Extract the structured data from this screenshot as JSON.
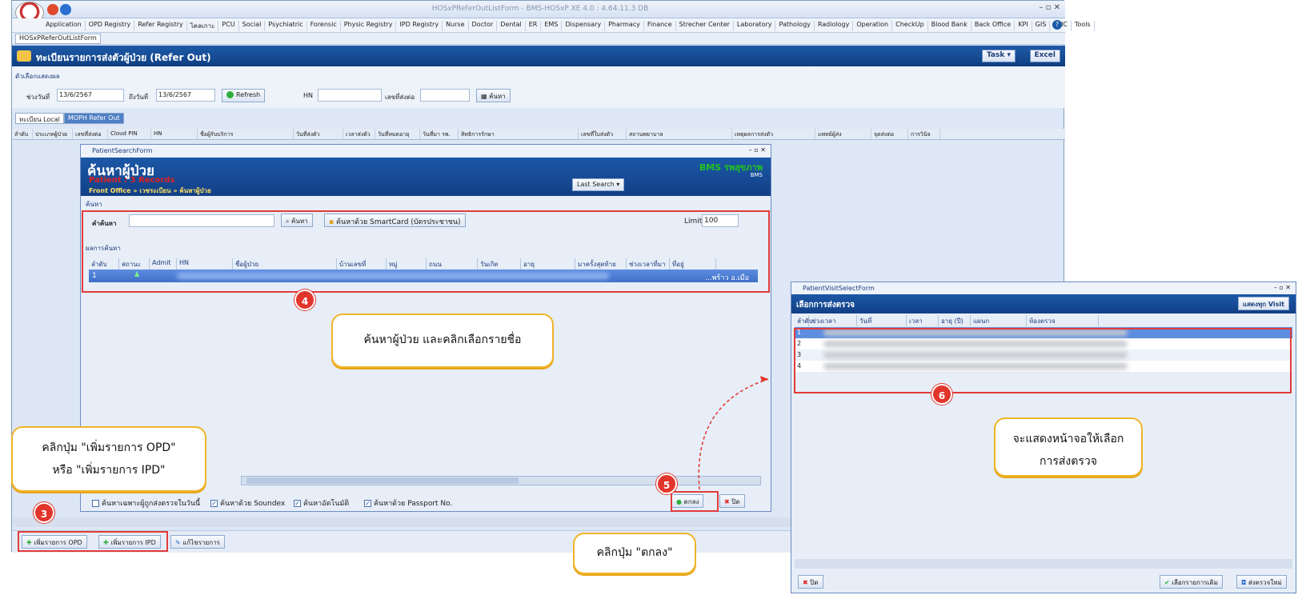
{
  "window": {
    "title": "HOSxPReferOutListForm - BMS-HOSxP XE 4.0 : 4.64.11.3 DB",
    "controls": "– ▫ ✕"
  },
  "menu": [
    "Application",
    "OPD Registry",
    "Refer Registry",
    "ไคลเกาะ",
    "PCU",
    "Social",
    "Psychiatric",
    "Forensic",
    "Physic Registry",
    "IPD Registry",
    "Nurse",
    "Doctor",
    "Dental",
    "ER",
    "EMS",
    "Dispensary",
    "Pharmacy",
    "Finance",
    "Strecher Center",
    "Laboratory",
    "Pathology",
    "Radiology",
    "Operation",
    "CheckUp",
    "Blood Bank",
    "Back Office",
    "KPI",
    "GIS",
    "HHC",
    "Tools"
  ],
  "doc_tab": "HOSxPReferOutListForm",
  "header": {
    "title": "ทะเบียนรายการส่งตัวผู้ป่วย (Refer Out)",
    "task": "Task ▾",
    "excel": "Excel"
  },
  "filter": {
    "section": "ตัวเลือกแสดงผล",
    "from_label": "ช่วงวันที่",
    "from": "13/6/2567",
    "to_label": "ถึงวันที่",
    "to": "13/6/2567",
    "refresh": "Refresh",
    "hn_label": "HN",
    "refer_label": "เลขที่ส่งต่อ",
    "search": "ค้นหา"
  },
  "tabs": [
    "ทะเบียน Local",
    "MOPH Refer Out"
  ],
  "grid_cols": [
    "ลำดับ",
    "ประเภทผู้ป่วย",
    "เลขที่ส่งต่อ",
    "Cloud PIN",
    "HN",
    "ชื่อผู้รับบริการ",
    "วันที่ส่งตัว",
    "เวลาส่งตัว",
    "วันที่หมดอายุ",
    "วันที่มา รพ.",
    "สิทธิการรักษา",
    "เลขที่ใบส่งตัว",
    "สถานพยาบาล",
    "เหตุผลการส่งตัว",
    "แพทย์ผู้ส่ง",
    "จุดส่งต่อ",
    "การวินิจ"
  ],
  "bottom": {
    "add_opd": "เพิ่มรายการ OPD",
    "add_ipd": "เพิ่มรายการ IPD",
    "edit": "แก้ไขรายการ"
  },
  "psf": {
    "title": "PatientSearchForm",
    "heading": "ค้นหาผู้ป่วย",
    "records": "Patient : 3 Records",
    "crumb": "Front Office » เวชระเบียน » ค้นหาผู้ป่วย",
    "bms": "BMS รพสุขภาพ",
    "bms_sub": "BMS",
    "last_search": "Last Search ▾",
    "search_group": "ค้นหา",
    "keyword_label": "คำค้นหา",
    "search_btn": "ค้นหา",
    "smartcard_btn": "ค้นหาด้วย SmartCard (บัตรประชาชน)",
    "limit_label": "Limit",
    "limit": "100",
    "results_label": "ผลการค้นหา",
    "cols": [
      "ลำดับ",
      "สถานะ",
      "Admit",
      "HN",
      "ชื่อผู้ป่วย",
      "บ้านเลขที่",
      "หมู่",
      "ถนน",
      "วันเกิด",
      "อายุ",
      "มาครั้งสุดท้าย",
      "ช่วงเวลาที่มา",
      "ที่อยู่"
    ],
    "row": {
      "no": "1",
      "addr": "...พร้าว อ.เมือ"
    },
    "opts": [
      "ค้นหาเฉพาะผู้ถูกส่งตรวจในวันนี้",
      "ค้นหาด้วย Soundex",
      "ค้นหาอัตโนมัติ",
      "ค้นหาด้วย Passport No."
    ],
    "ok": "ตกลง",
    "close": "ปิด"
  },
  "pvsf": {
    "title": "PatientVisitSelectForm",
    "heading": "เลือกการส่งตรวจ",
    "show_all": "แสดงทุก Visit",
    "cols": [
      "ลำดับ",
      "ช่วงเวลา",
      "วันที่",
      "เวลา",
      "อายุ (ปี)",
      "แผนก",
      "ห้องตรวจ"
    ],
    "rows": [
      "1",
      "2",
      "3",
      "4"
    ],
    "close": "ปิด",
    "select_btn": "เลือกรายการเดิม",
    "new_btn": "ส่งตรวจใหม่"
  },
  "annotations": {
    "step3": "3",
    "step4": "4",
    "step5": "5",
    "step6": "6",
    "call3_l1": "คลิกปุ่ม \"เพิ่มรายการ OPD\"",
    "call3_l2": "หรือ \"เพิ่มรายการ IPD\"",
    "call4": "ค้นหาผู้ป่วย และคลิกเลือกรายชื่อ",
    "call5": "คลิกปุ่ม \"ตกลง\"",
    "call6_l1": "จะแสดงหน้าจอให้เลือก",
    "call6_l2": "การส่งตรวจ"
  },
  "colors": {
    "accent": "#1b58a6",
    "annotation_red": "#e2352c",
    "callout_border": "#f0b428"
  }
}
